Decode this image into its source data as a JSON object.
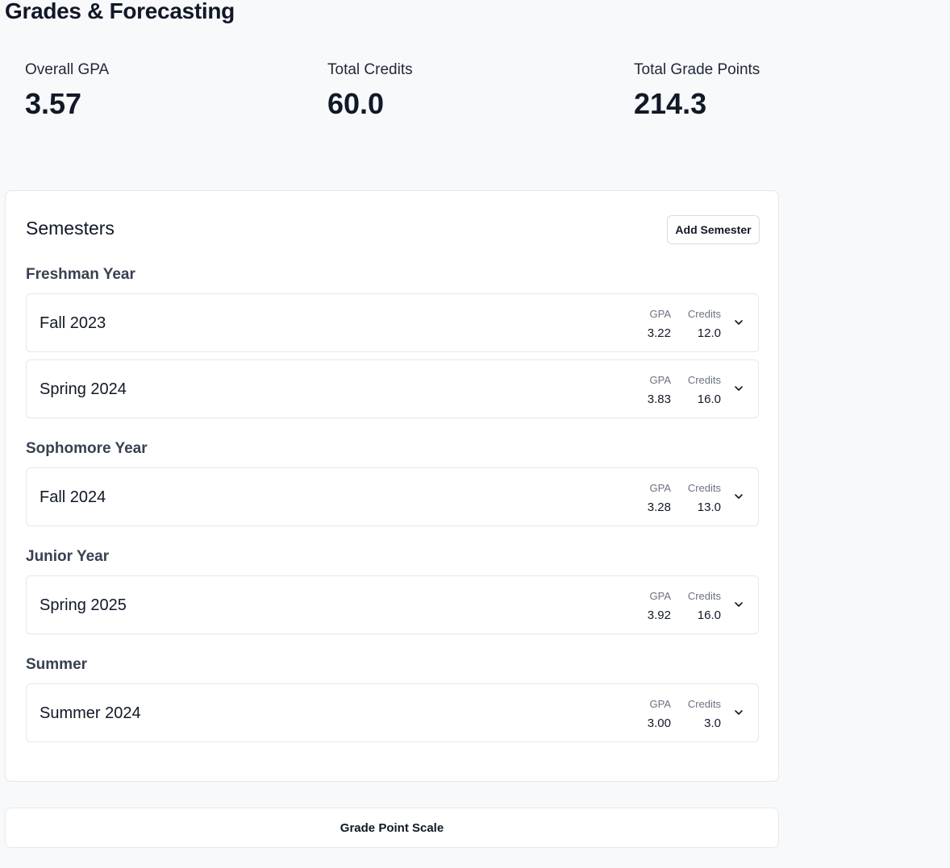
{
  "page": {
    "title": "Grades & Forecasting"
  },
  "stats": [
    {
      "label": "Overall GPA",
      "value": "3.57"
    },
    {
      "label": "Total Credits",
      "value": "60.0"
    },
    {
      "label": "Total Grade Points",
      "value": "214.3"
    }
  ],
  "semesters": {
    "title": "Semesters",
    "add_label": "Add Semester",
    "metric_gpa_label": "GPA",
    "metric_credits_label": "Credits",
    "groups": [
      {
        "heading": "Freshman Year",
        "items": [
          {
            "name": "Fall 2023",
            "gpa": "3.22",
            "credits": "12.0"
          },
          {
            "name": "Spring 2024",
            "gpa": "3.83",
            "credits": "16.0"
          }
        ]
      },
      {
        "heading": "Sophomore Year",
        "items": [
          {
            "name": "Fall 2024",
            "gpa": "3.28",
            "credits": "13.0"
          }
        ]
      },
      {
        "heading": "Junior Year",
        "items": [
          {
            "name": "Spring 2025",
            "gpa": "3.92",
            "credits": "16.0"
          }
        ]
      },
      {
        "heading": "Summer",
        "items": [
          {
            "name": "Summer 2024",
            "gpa": "3.00",
            "credits": "3.0"
          }
        ]
      }
    ]
  },
  "grade_scale": {
    "label": "Grade Point Scale"
  }
}
